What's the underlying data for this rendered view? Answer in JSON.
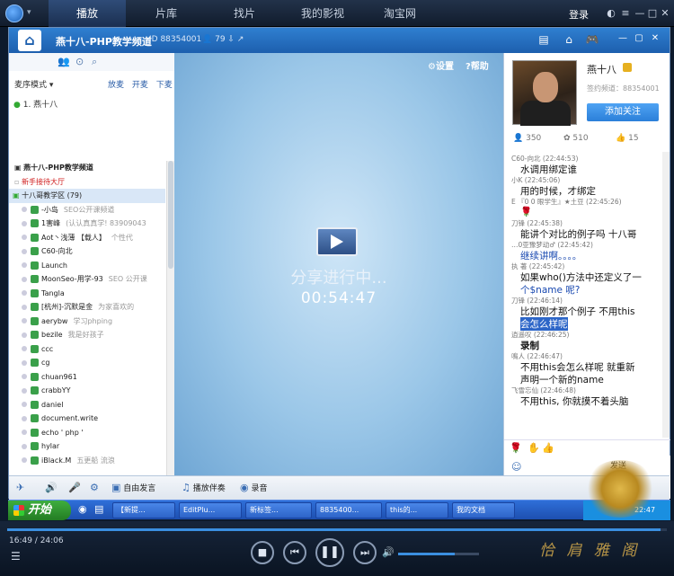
{
  "topbar": {
    "tabs": [
      "播放",
      "片库",
      "找片",
      "我的影视",
      "淘宝网"
    ],
    "login": "登录"
  },
  "channel": {
    "title": "燕十八-PHP教学频道",
    "id_text": "ID 88354001",
    "users": "79",
    "mode_label": "麦序模式",
    "mode_links": [
      "放麦",
      "开麦",
      "下麦"
    ],
    "queue_item": "1. 燕十八",
    "tree": [
      {
        "text": "燕十八-PHP教学频道",
        "style": "root"
      },
      {
        "text": "新手接待大厅",
        "style": "red"
      },
      {
        "text": "十八哥教学区 (79)",
        "style": "group"
      },
      {
        "text": "-小岛",
        "sig": "SEO公开课频道"
      },
      {
        "text": "1害峰",
        "sig": "(认认真真学! 83909043"
      },
      {
        "text": "Aot丶浅薄  【载人】",
        "sig": "个性代"
      },
      {
        "text": "C60-向北",
        "sig": ""
      },
      {
        "text": "Launch",
        "sig": ""
      },
      {
        "text": "MoonSeo-用学-93",
        "sig": "SEO 公开课"
      },
      {
        "text": "Tangla",
        "sig": ""
      },
      {
        "text": "[杭州]-沉默是金",
        "sig": "为家喜欢的"
      },
      {
        "text": "aerybw",
        "sig": "学习phping"
      },
      {
        "text": "bezile",
        "sig": "我是好孩子"
      },
      {
        "text": "ccc",
        "sig": ""
      },
      {
        "text": "cg",
        "sig": ""
      },
      {
        "text": "chuan961",
        "sig": ""
      },
      {
        "text": "crabbYY",
        "sig": ""
      },
      {
        "text": "daniel",
        "sig": ""
      },
      {
        "text": "document.write",
        "sig": ""
      },
      {
        "text": "echo ' php '",
        "sig": ""
      },
      {
        "text": "hylar",
        "sig": ""
      },
      {
        "text": "iBlack.M",
        "sig": "五更船 流浪"
      }
    ],
    "video": {
      "settings": "设置",
      "help": "帮助",
      "share_text": "分享进行中...",
      "timer": "00:54:47"
    },
    "profile": {
      "name": "燕十八",
      "sign_id": "签约频道：88354001",
      "follow": "添加关注",
      "stats": [
        "350",
        "510",
        "15"
      ]
    },
    "chat": [
      {
        "meta": "C60-向北 (22:44:53)",
        "text": "水调用绑定谁"
      },
      {
        "meta": "小K (22:45:06)",
        "text": "用的时候，才绑定"
      },
      {
        "meta": "E 『0 0 眼学生』★土豆 (22:45:26)",
        "text": "🌹"
      },
      {
        "meta": "刀锋 (22:45:38)",
        "text": "能讲个对比的例子吗 十八哥"
      },
      {
        "meta": "…0亚豫梦动♂ (22:45:42)",
        "text": "继续讲啊。。。。",
        "style": "blue"
      },
      {
        "meta": "执 著 (22:45:42)",
        "text": "如果who()方法中还定义了一"
      },
      {
        "meta": "",
        "text": "个$name 呢?",
        "style": "blue"
      },
      {
        "meta": "刀锋 (22:46:14)",
        "text": "比如刚才那个例子  不用this"
      },
      {
        "meta": "",
        "text": "会怎么样呢",
        "style": "sel"
      },
      {
        "meta": "逍遥叹 (22:46:25)",
        "text": "录制",
        "style": "bold"
      },
      {
        "meta": "鳴人 (22:46:47)",
        "text": "不用this会怎么样呢 就重新"
      },
      {
        "meta": "",
        "text": "声明一个新的name"
      },
      {
        "meta": "飞雪忘仙 (22:46:48)",
        "text": "不用this, 你就摸不着头脑"
      }
    ],
    "send": "发送",
    "bottom_tools": [
      "自由发言",
      "播放伴奏",
      "录音"
    ]
  },
  "taskbar": {
    "start": "开始",
    "tasks": [
      "【新提...",
      "EditPlu...",
      "新标签...",
      "8835400...",
      "this的...",
      "我的文档"
    ],
    "clock": "22:47"
  },
  "controls": {
    "time": "16:49 / 24:06",
    "progress": 0.99,
    "volume": 0.7
  },
  "brand": "恰 肩 雅 阁"
}
